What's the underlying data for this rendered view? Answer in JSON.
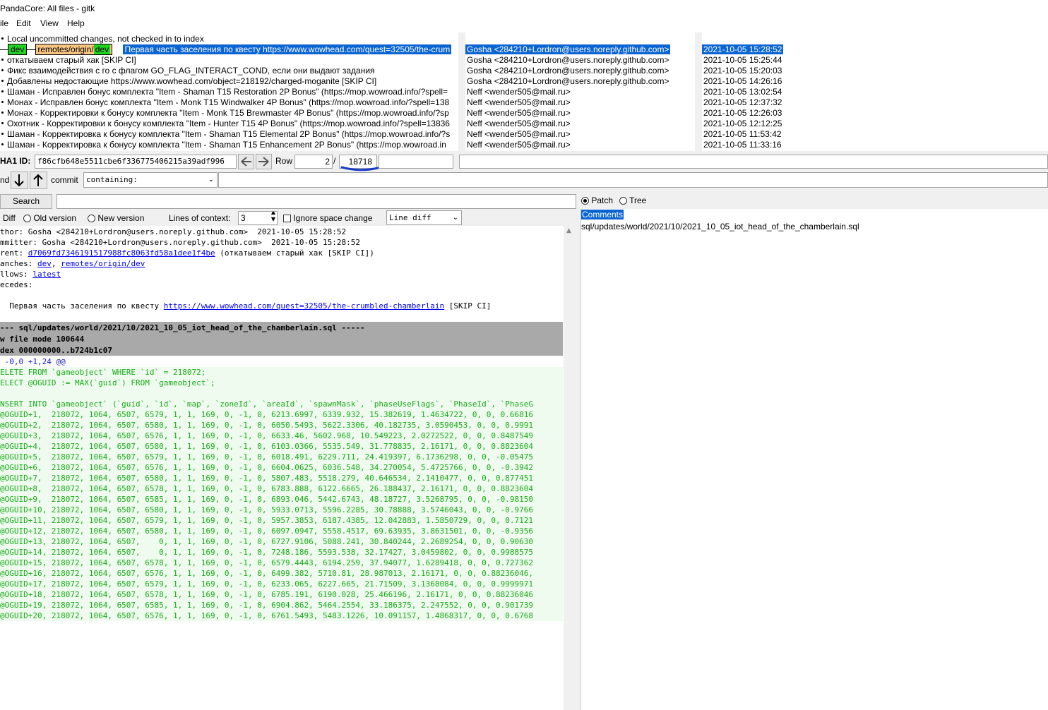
{
  "window": {
    "title": "PandaCore: All files - gitk"
  },
  "menu": {
    "file": "ile",
    "edit": "Edit",
    "view": "View",
    "help": "Help"
  },
  "commits": {
    "header": "Local uncommitted changes, not checked in to index",
    "selected": {
      "branch_local": "dev",
      "branch_remote_prefix": "remotes/origin/",
      "branch_remote": "dev",
      "message": "Первая часть заселения по квесту https://www.wowhead.com/quest=32505/the-crum",
      "author": "Gosha <284210+Lordron@users.noreply.github.com>",
      "date": "2021-10-05 15:28:52"
    },
    "list": [
      {
        "message": "откатываем старый хак [SKIP CI]",
        "author": "Gosha <284210+Lordron@users.noreply.github.com>",
        "date": "2021-10-05 15:25:44"
      },
      {
        "message": "Фикс взаимодействия с го с флагом GO_FLAG_INTERACT_COND, если они выдают задания",
        "author": "Gosha <284210+Lordron@users.noreply.github.com>",
        "date": "2021-10-05 15:20:03"
      },
      {
        "message": "Добавлены недостающие https://www.wowhead.com/object=218192/charged-moganite [SKIP CI]",
        "author": "Gosha <284210+Lordron@users.noreply.github.com>",
        "date": "2021-10-05 14:26:16"
      },
      {
        "message": "Шаман - Исправлен бонус комплекта \"Item - Shaman T15 Restoration 2P Bonus\" (https://mop.wowroad.info/?spell=",
        "author": "Neff <wender505@mail.ru>",
        "date": "2021-10-05 13:02:54"
      },
      {
        "message": "Монах - Исправлен бонус комплекта \"Item - Monk T15 Windwalker 4P Bonus\" (https://mop.wowroad.info/?spell=138",
        "author": "Neff <wender505@mail.ru>",
        "date": "2021-10-05 12:37:32"
      },
      {
        "message": "Монах - Корректировки к бонусу комплекта \"Item - Monk T15 Brewmaster 4P Bonus\" (https://mop.wowroad.info/?sp",
        "author": "Neff <wender505@mail.ru>",
        "date": "2021-10-05 12:26:03"
      },
      {
        "message": "Охотник - Корректировки к бонусу комплекта \"Item - Hunter T15 4P Bonus\" (https://mop.wowroad.info/?spell=13836",
        "author": "Neff <wender505@mail.ru>",
        "date": "2021-10-05 12:12:25"
      },
      {
        "message": "Шаман - Корректировка к бонусу комплекта \"Item - Shaman T15 Elemental 2P Bonus\" (https://mop.wowroad.info/?s",
        "author": "Neff <wender505@mail.ru>",
        "date": "2021-10-05 11:53:42"
      },
      {
        "message": "Шаман - Корректировка к бонусу комплекта \"Item - Shaman T15 Enhancement 2P Bonus\" (https://mop.wowroad.in",
        "author": "Neff <wender505@mail.ru>",
        "date": "2021-10-05 11:33:16"
      }
    ]
  },
  "sha": {
    "label": "HA1 ID:",
    "value": "f86cfb648e5511cbe6f336775406215a39adf996",
    "back_icon": "arrow-left",
    "forward_icon": "arrow-right",
    "row_label": "Row",
    "row_value": "2",
    "row_sep": "/",
    "row_total": "18718"
  },
  "find": {
    "label": "nd",
    "down_icon": "arrow-down",
    "up_icon": "arrow-up",
    "type": "commit",
    "mode": "containing:"
  },
  "search": {
    "button": "Search"
  },
  "diff_options": {
    "diff_label": "Diff",
    "old_version": "Old version",
    "new_version": "New version",
    "context_label": "Lines of context:",
    "context_value": "3",
    "ignore_space": "Ignore space change",
    "diff_mode": "Line diff"
  },
  "patch_tree": {
    "patch": "Patch",
    "tree": "Tree",
    "comments": "Comments",
    "file": "sql/updates/world/2021/10/2021_10_05_iot_head_of_the_chamberlain.sql"
  },
  "details": {
    "author_label": "thor:",
    "author": "Gosha <284210+Lordron@users.noreply.github.com>  2021-10-05 15:28:52",
    "committer_label": "mmitter:",
    "committer": "Gosha <284210+Lordron@users.noreply.github.com>  2021-10-05 15:28:52",
    "parent_label": "rent:",
    "parent_hash": "d7069fd7346191517988fc8063fd58a1dee1f4be",
    "parent_msg": " (откатываем старый хак [SKIP CI])",
    "branches_label": "anches:",
    "branch_a": "dev",
    "branch_sep": ", ",
    "branch_b": "remotes/origin/dev",
    "follows_label": "llows:",
    "follows": "latest",
    "precedes_label": "ecedes:",
    "msg_prefix": "  Первая часть заселения по квесту ",
    "msg_link": "https://www.wowhead.com/quest=32505/the-crumbled-chamberlain",
    "msg_suffix": " [SKIP CI]"
  },
  "diff": {
    "file_header": "--- sql/updates/world/2021/10/2021_10_05_iot_head_of_the_chamberlain.sql -----",
    "mode_line": "w file mode 100644",
    "index_line": "dex 000000000..b724b1c07",
    "hunk": " -0,0 +1,24 @@",
    "lines": [
      "ELETE FROM `gameobject` WHERE `id` = 218072;",
      "ELECT @OGUID := MAX(`guid`) FROM `gameobject`;",
      "",
      "NSERT INTO `gameobject` (`guid`, `id`, `map`, `zoneId`, `areaId`, `spawnMask`, `phaseUseFlags`, `PhaseId`, `PhaseG",
      "@OGUID+1,  218072, 1064, 6507, 6579, 1, 1, 169, 0, -1, 0, 6213.6997, 6339.932, 15.382619, 1.4634722, 0, 0, 0.66816",
      "@OGUID+2,  218072, 1064, 6507, 6580, 1, 1, 169, 0, -1, 0, 6050.5493, 5622.3306, 40.182735, 3.0590453, 0, 0, 0.9991",
      "@OGUID+3,  218072, 1064, 6507, 6576, 1, 1, 169, 0, -1, 0, 6633.46, 5602.968, 10.549223, 2.0272522, 0, 0, 0.8487549",
      "@OGUID+4,  218072, 1064, 6507, 6580, 1, 1, 169, 0, -1, 0, 6103.0366, 5535.549, 31.778835, 2.16171, 0, 0, 0.8823604",
      "@OGUID+5,  218072, 1064, 6507, 6579, 1, 1, 169, 0, -1, 0, 6018.491, 6229.711, 24.419397, 6.1736298, 0, 0, -0.05475",
      "@OGUID+6,  218072, 1064, 6507, 6576, 1, 1, 169, 0, -1, 0, 6604.0625, 6036.548, 34.270054, 5.4725766, 0, 0, -0.3942",
      "@OGUID+7,  218072, 1064, 6507, 6580, 1, 1, 169, 0, -1, 0, 5807.483, 5518.279, 40.646534, 2.1410477, 0, 0, 0.877451",
      "@OGUID+8,  218072, 1064, 6507, 6578, 1, 1, 169, 0, -1, 0, 6783.888, 6122.6665, 26.188437, 2.16171, 0, 0, 0.8823604",
      "@OGUID+9,  218072, 1064, 6507, 6585, 1, 1, 169, 0, -1, 0, 6893.046, 5442.6743, 48.18727, 3.5268795, 0, 0, -0.98150",
      "@OGUID+10, 218072, 1064, 6507, 6580, 1, 1, 169, 0, -1, 0, 5933.0713, 5596.2285, 30.78888, 3.5746043, 0, 0, -0.9766",
      "@OGUID+11, 218072, 1064, 6507, 6579, 1, 1, 169, 0, -1, 0, 5957.3853, 6187.4385, 12.042883, 1.5850729, 0, 0, 0.7121",
      "@OGUID+12, 218072, 1064, 6507, 6580, 1, 1, 169, 0, -1, 0, 6097.0947, 5558.4517, 69.63935, 3.8631501, 0, 0, -0.9356",
      "@OGUID+13, 218072, 1064, 6507,    0, 1, 1, 169, 0, -1, 0, 6727.9106, 5088.241, 30.840244, 2.2689254, 0, 0, 0.90630",
      "@OGUID+14, 218072, 1064, 6507,    0, 1, 1, 169, 0, -1, 0, 7248.186, 5593.538, 32.17427, 3.0459802, 0, 0, 0.9988575",
      "@OGUID+15, 218072, 1064, 6507, 6578, 1, 1, 169, 0, -1, 0, 6579.4443, 6194.259, 37.94077, 1.6289418, 0, 0, 0.727362",
      "@OGUID+16, 218072, 1064, 6507, 6576, 1, 1, 169, 0, -1, 0, 6499.382, 5710.81, 28.987013, 2.16171, 0, 0, 0.88236046,",
      "@OGUID+17, 218072, 1064, 6507, 6579, 1, 1, 169, 0, -1, 0, 6233.065, 6227.665, 21.71509, 3.1368084, 0, 0, 0.9999971",
      "@OGUID+18, 218072, 1064, 6507, 6578, 1, 1, 169, 0, -1, 0, 6785.191, 6190.028, 25.466196, 2.16171, 0, 0, 0.88236046",
      "@OGUID+19, 218072, 1064, 6507, 6585, 1, 1, 169, 0, -1, 0, 6904.862, 5464.2554, 33.186375, 2.247552, 0, 0, 0.901739",
      "@OGUID+20, 218072, 1064, 6507, 6576, 1, 1, 169, 0, -1, 0, 6761.5493, 5483.1226, 10.091157, 1.4868317, 0, 0, 0.6768"
    ]
  },
  "colors": {
    "selection": "#0a64d2",
    "local_branch": "#22d422",
    "remote_branch": "#f7c683",
    "diff_add": "#1aaa1a",
    "diff_header_bg": "#a9a9a9"
  }
}
